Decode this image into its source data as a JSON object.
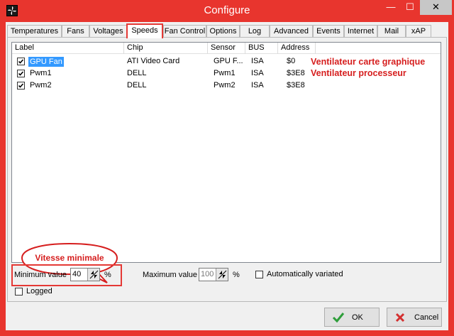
{
  "window": {
    "title": "Configure",
    "colors": {
      "frame": "#e8352e",
      "highlight": "#e53935",
      "annotation": "#d61e1e",
      "selection": "#3399ff"
    }
  },
  "titlebar": {
    "minimize": "—",
    "maximize": "☐",
    "close": "✕"
  },
  "tabs": [
    {
      "label": "Temperatures"
    },
    {
      "label": "Fans"
    },
    {
      "label": "Voltages"
    },
    {
      "label": "Speeds",
      "active": true
    },
    {
      "label": "Fan Control"
    },
    {
      "label": "Options"
    },
    {
      "label": "Log"
    },
    {
      "label": "Advanced"
    },
    {
      "label": "Events"
    },
    {
      "label": "Internet"
    },
    {
      "label": "Mail"
    },
    {
      "label": "xAP"
    }
  ],
  "list": {
    "columns": [
      "Label",
      "Chip",
      "Sensor",
      "BUS",
      "Address"
    ],
    "rows": [
      {
        "checked": true,
        "label": "GPU Fan",
        "chip": "ATI Video Card",
        "sensor": "GPU F...",
        "bus": "ISA",
        "address": "$0",
        "selected": true
      },
      {
        "checked": true,
        "label": "Pwm1",
        "chip": "DELL",
        "sensor": "Pwm1",
        "bus": "ISA",
        "address": "$3E8"
      },
      {
        "checked": true,
        "label": "Pwm2",
        "chip": "DELL",
        "sensor": "Pwm2",
        "bus": "ISA",
        "address": "$3E8"
      }
    ]
  },
  "annotations": {
    "gpu_fan": "Ventilateur carte graphique",
    "cpu_fan": "Ventilateur processeur",
    "bubble": "Vitesse minimale"
  },
  "settings": {
    "min_label": "Minimum value",
    "min_value": "40",
    "min_unit": "%",
    "max_label": "Maximum value",
    "max_value": "100",
    "max_unit": "%",
    "auto_label": "Automatically variated",
    "auto_checked": false,
    "logged_label": "Logged",
    "logged_checked": false
  },
  "buttons": {
    "ok": "OK",
    "cancel": "Cancel"
  },
  "icons": {
    "app": "fan-icon",
    "ok": "checkmark-icon",
    "cancel": "x-icon"
  }
}
